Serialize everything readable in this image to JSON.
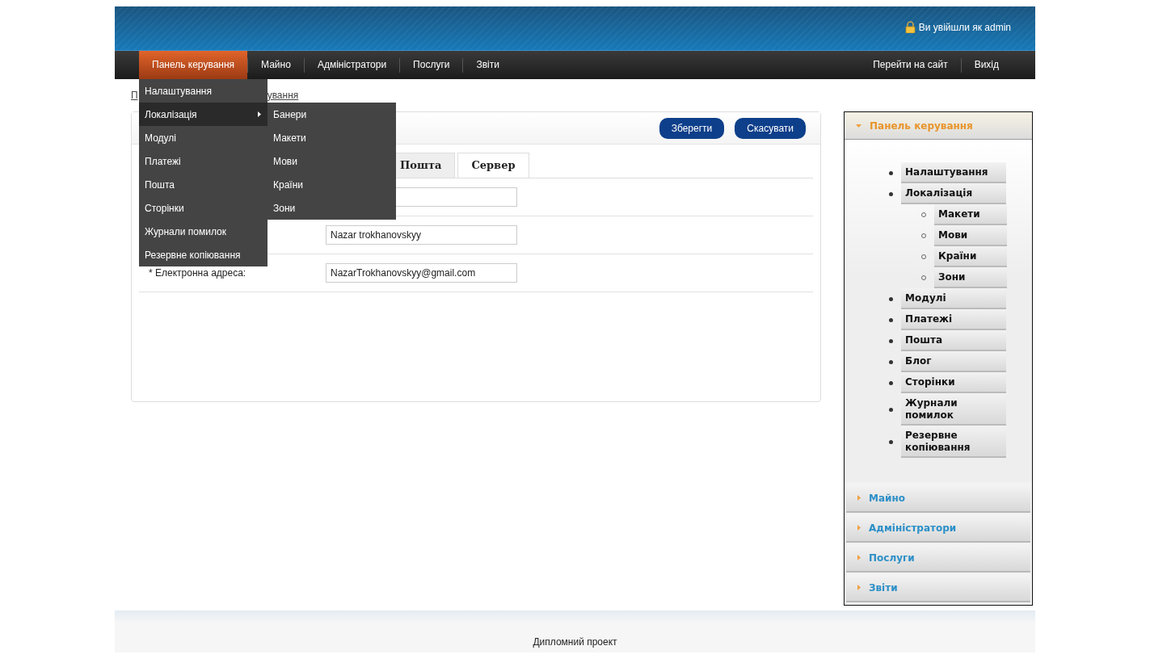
{
  "header": {
    "login_text": "Ви увійшли як admin"
  },
  "nav": {
    "items": [
      {
        "label": "Панель керування",
        "selected": true
      },
      {
        "label": "Майно",
        "selected": false
      },
      {
        "label": "Адміністратори",
        "selected": false
      },
      {
        "label": "Послуги",
        "selected": false
      },
      {
        "label": "Звіти",
        "selected": false
      }
    ],
    "right_items": [
      {
        "label": "Перейти на сайт"
      },
      {
        "label": "Вихід"
      }
    ]
  },
  "dropdown": {
    "items": [
      {
        "label": "Налаштування",
        "has_submenu": false,
        "selected": false
      },
      {
        "label": "Локалізація",
        "has_submenu": true,
        "selected": true
      },
      {
        "label": "Модулі",
        "has_submenu": false,
        "selected": false
      },
      {
        "label": "Платежі",
        "has_submenu": false,
        "selected": false
      },
      {
        "label": "Пошта",
        "has_submenu": false,
        "selected": false
      },
      {
        "label": "Сторінки",
        "has_submenu": false,
        "selected": false
      },
      {
        "label": "Журнали помилок",
        "has_submenu": false,
        "selected": false
      },
      {
        "label": "Резервне копіювання",
        "has_submenu": false,
        "selected": false
      }
    ],
    "submenu": [
      {
        "label": "Банери"
      },
      {
        "label": "Макети"
      },
      {
        "label": "Мови"
      },
      {
        "label": "Країни"
      },
      {
        "label": "Зони"
      }
    ]
  },
  "breadcrumb": [
    {
      "label": "П"
    },
    {
      "label": "ування"
    }
  ],
  "panel": {
    "buttons": [
      "Зберегти",
      "Скасувати"
    ],
    "tabs": [
      {
        "label": "Пошта",
        "selected": false
      },
      {
        "label": "Сервер",
        "selected": true
      }
    ],
    "fields": [
      {
        "kind": "input"
      },
      {
        "kind": "input",
        "value": "Nazar trokhanovskyy"
      },
      {
        "kind": "labeled_input",
        "label": "* Електронна адреса:",
        "value": "NazarTrokhanovskyy@gmail.com"
      }
    ]
  },
  "sidebar": {
    "sections": [
      {
        "title": "Панель керування",
        "expanded": true,
        "items": [
          {
            "label": "Налаштування"
          },
          {
            "label": "Локалізація",
            "children": [
              {
                "label": "Макети"
              },
              {
                "label": "Мови"
              },
              {
                "label": "Країни"
              },
              {
                "label": "Зони"
              }
            ]
          },
          {
            "label": "Модулі"
          },
          {
            "label": "Платежі"
          },
          {
            "label": "Пошта"
          },
          {
            "label": "Блог"
          },
          {
            "label": "Сторінки"
          },
          {
            "label": "Журнали помилок"
          },
          {
            "label": "Резервне копіювання"
          }
        ]
      },
      {
        "title": "Майно",
        "expanded": false
      },
      {
        "title": "Адміністратори",
        "expanded": false
      },
      {
        "title": "Послуги",
        "expanded": false
      },
      {
        "title": "Звіти",
        "expanded": false
      }
    ]
  },
  "footer": {
    "text": "Дипломний проект"
  }
}
